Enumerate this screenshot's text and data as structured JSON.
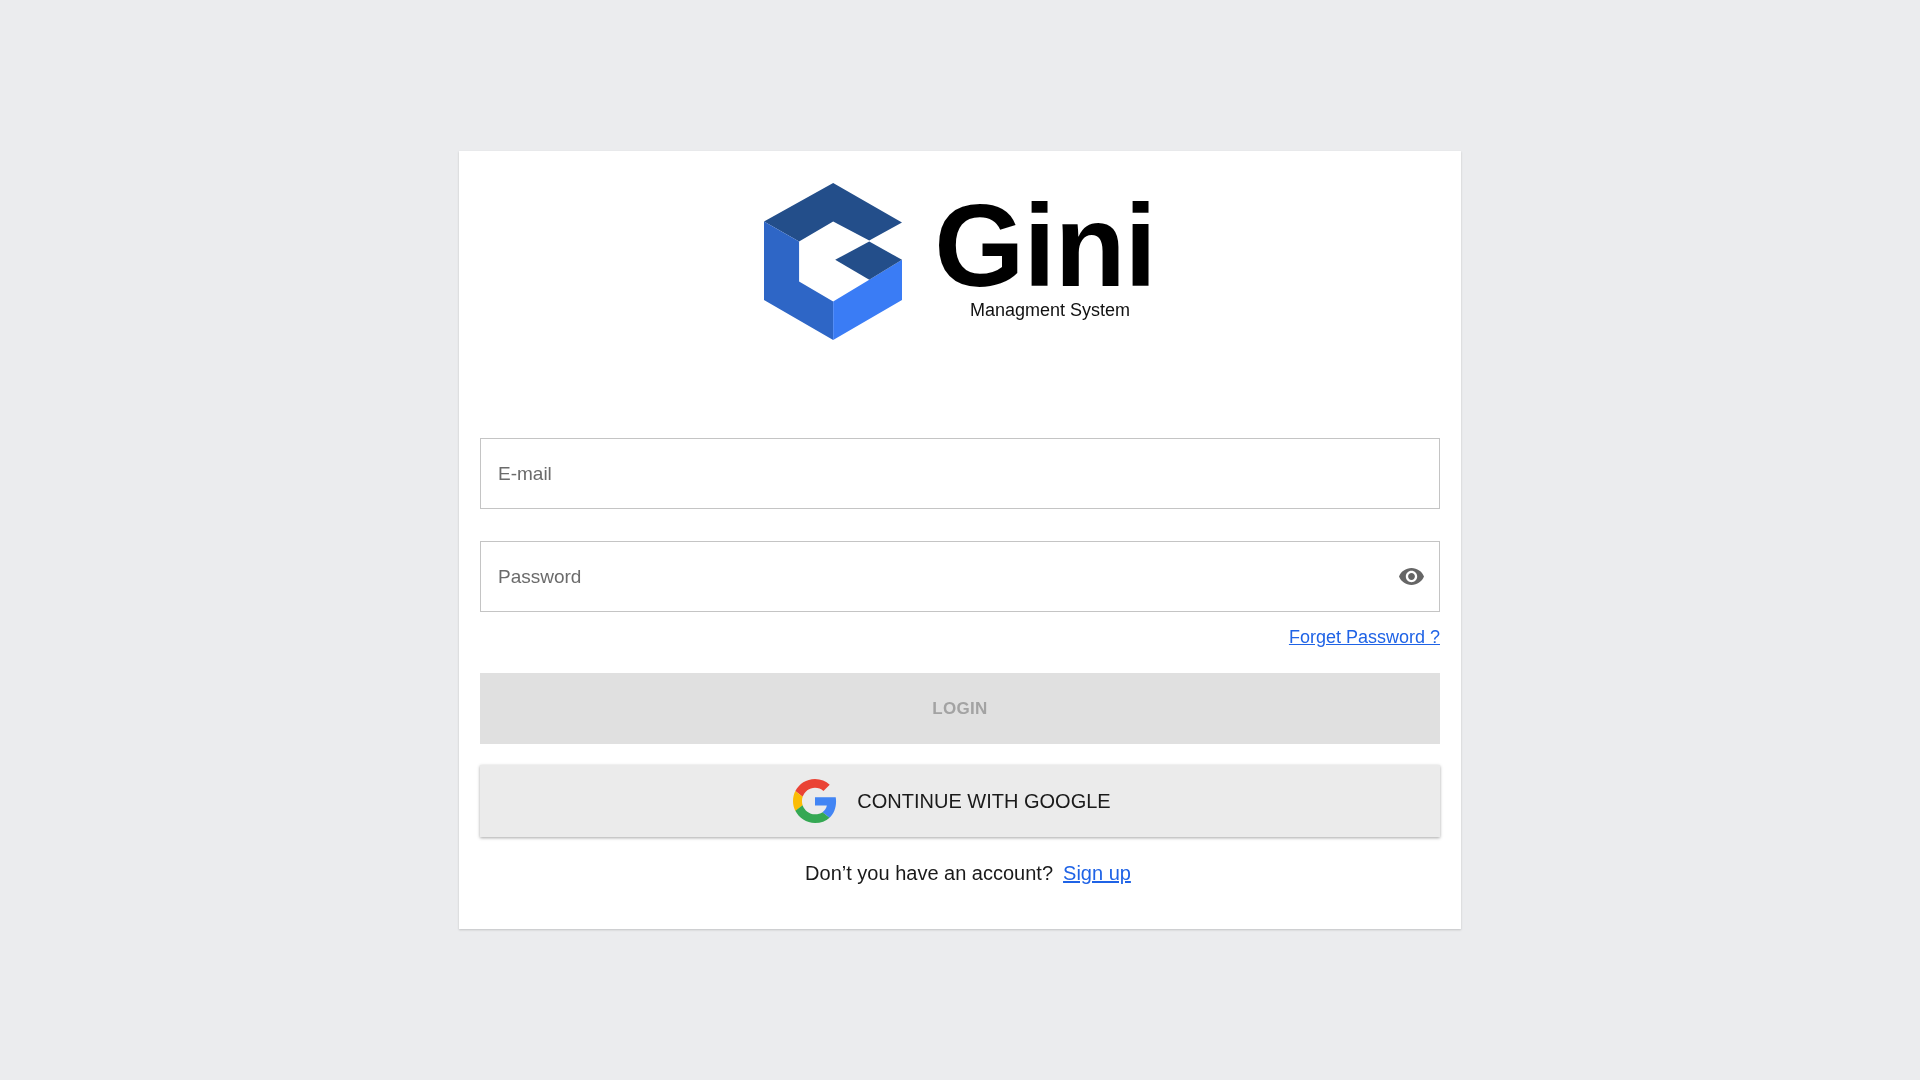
{
  "logo": {
    "title": "Gini",
    "subtitle": "Managment System"
  },
  "fields": [
    {
      "kind": "email",
      "placeholder": "E-mail"
    },
    {
      "kind": "password",
      "placeholder": "Password"
    }
  ],
  "forgot_link": "Forget Password ?",
  "login_button": {
    "label": "LOGIN",
    "disabled": true
  },
  "google_button": {
    "label": "CONTINUE WITH GOOGLE"
  },
  "signup": {
    "prompt": "Don’t you have an account?",
    "link": "Sign up"
  }
}
